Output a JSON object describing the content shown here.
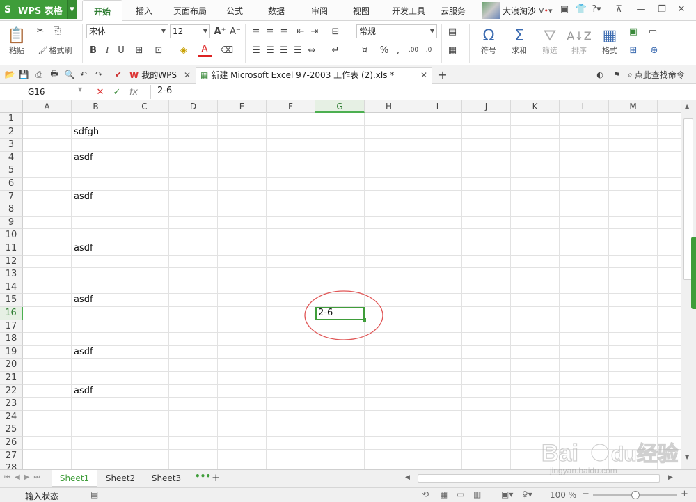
{
  "app": {
    "name": "WPS 表格"
  },
  "menu_tabs": [
    "开始",
    "插入",
    "页面布局",
    "公式",
    "数据",
    "审阅",
    "视图",
    "开发工具",
    "云服务"
  ],
  "active_menu_tab": "开始",
  "user": {
    "name": "大浪淘沙"
  },
  "ribbon": {
    "paste": "粘贴",
    "copy": "复制",
    "format_painter": "格式刷",
    "font_name": "宋体",
    "font_size": "12",
    "bold": "B",
    "italic": "I",
    "underline": "U",
    "number_format": "常规",
    "percent": "%",
    "comma": ",",
    "symbol": "符号",
    "sum": "求和",
    "filter": "筛选",
    "sort": "排序",
    "format": "格式"
  },
  "doc_tabs": [
    {
      "label": "我的WPS",
      "active": false
    },
    {
      "label": "新建 Microsoft Excel 97-2003 工作表 (2).xls *",
      "active": true
    }
  ],
  "search_command": "点此查找命令",
  "formula_bar": {
    "name_box": "G16",
    "fx": "fx",
    "value": "2-6"
  },
  "columns": [
    "A",
    "B",
    "C",
    "D",
    "E",
    "F",
    "G",
    "H",
    "I",
    "J",
    "K",
    "L",
    "M"
  ],
  "rows": [
    "1",
    "2",
    "3",
    "4",
    "5",
    "6",
    "7",
    "8",
    "9",
    "10",
    "11",
    "12",
    "13",
    "14",
    "15",
    "16",
    "17",
    "18",
    "19",
    "20",
    "21",
    "22",
    "23",
    "24",
    "25",
    "26",
    "27",
    "28"
  ],
  "cells": [
    {
      "ref": "B2",
      "value": "sdfgh"
    },
    {
      "ref": "B4",
      "value": "asdf"
    },
    {
      "ref": "B7",
      "value": "asdf"
    },
    {
      "ref": "B11",
      "value": "asdf"
    },
    {
      "ref": "B15",
      "value": "asdf"
    },
    {
      "ref": "G16",
      "value": "2-6"
    },
    {
      "ref": "B19",
      "value": "asdf"
    },
    {
      "ref": "B22",
      "value": "asdf"
    }
  ],
  "selected_cell": "G16",
  "annotation_color": "#e05555",
  "sheets": [
    "Sheet1",
    "Sheet2",
    "Sheet3"
  ],
  "active_sheet": "Sheet1",
  "status": {
    "mode": "输入状态",
    "zoom": "100 %"
  },
  "watermark": "Baidu经验 jingyan.baidu.com"
}
